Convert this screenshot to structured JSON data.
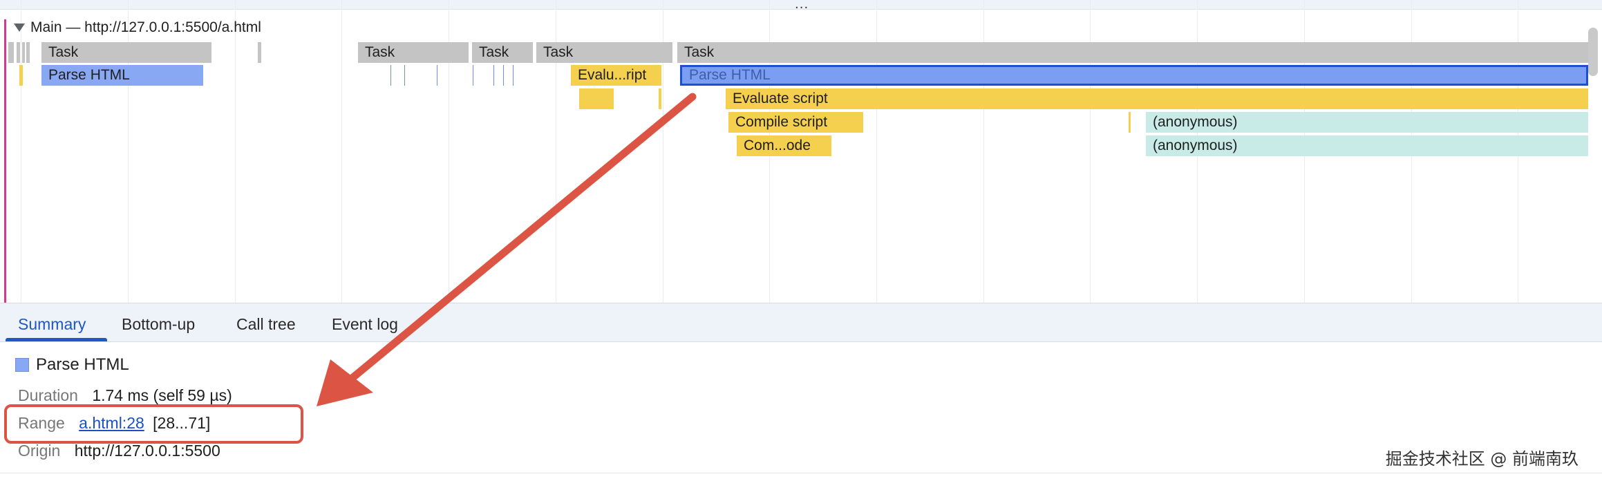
{
  "flame_chart": {
    "track_title": "Main — http://127.0.0.1:5500/a.html",
    "tasks": [
      "Task",
      "Task",
      "Task",
      "Task",
      "Task"
    ],
    "parse_html_1": "Parse HTML",
    "eval_short": "Evalu...ript",
    "parse_html_selected": "Parse HTML",
    "evaluate_script": "Evaluate script",
    "compile_script": "Compile script",
    "compile_code": "Com...ode",
    "anonymous_1": "(anonymous)",
    "anonymous_2": "(anonymous)",
    "overflow_menu": "..."
  },
  "tabs": {
    "summary": "Summary",
    "bottom_up": "Bottom-up",
    "call_tree": "Call tree",
    "event_log": "Event log"
  },
  "summary": {
    "title": "Parse HTML",
    "duration_label": "Duration",
    "duration_value": "1.74 ms (self 59 µs)",
    "range_label": "Range",
    "range_link": "a.html:28",
    "range_extra": "[28...71]",
    "origin_label": "Origin",
    "origin_value": "http://127.0.0.1:5500"
  },
  "watermark": "掘金技术社区 @ 前端南玖",
  "colors": {
    "task": "#c4c4c4",
    "parse_html": "#88a8f3",
    "script": "#f5cf4e",
    "anonymous": "#c9ebe7",
    "accent": "#1f57c3",
    "annotation": "#dc5544"
  }
}
